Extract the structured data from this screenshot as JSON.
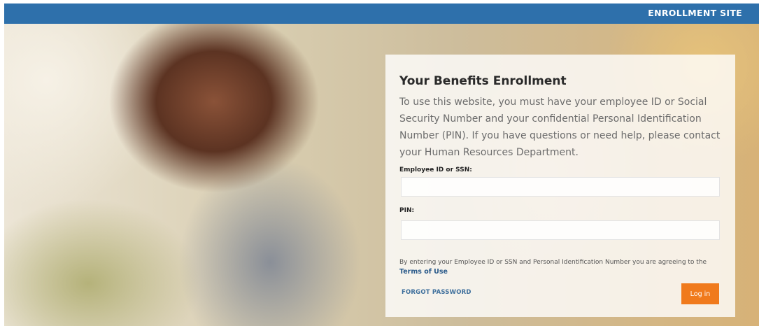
{
  "header": {
    "site_label": "ENROLLMENT SITE"
  },
  "login_panel": {
    "title": "Your Benefits Enrollment",
    "intro": "To use this website, you must have your employee ID or Social Security Number and your confidential Personal Identification Number (PIN). If you have questions or need help, please contact your Human Resources Department.",
    "employee_id_label": "Employee ID or SSN:",
    "employee_id_value": "",
    "pin_label": "PIN:",
    "pin_value": "",
    "agreement_text": "By entering your Employee ID or SSN and Personal Identification Number you are agreeing to the",
    "terms_link": "Terms of Use",
    "forgot_password": "FORGOT PASSWORD",
    "login_button": "Log in"
  },
  "colors": {
    "header_bar": "#2e70ab",
    "login_button": "#f07a1c",
    "link": "#2a5a8a"
  }
}
